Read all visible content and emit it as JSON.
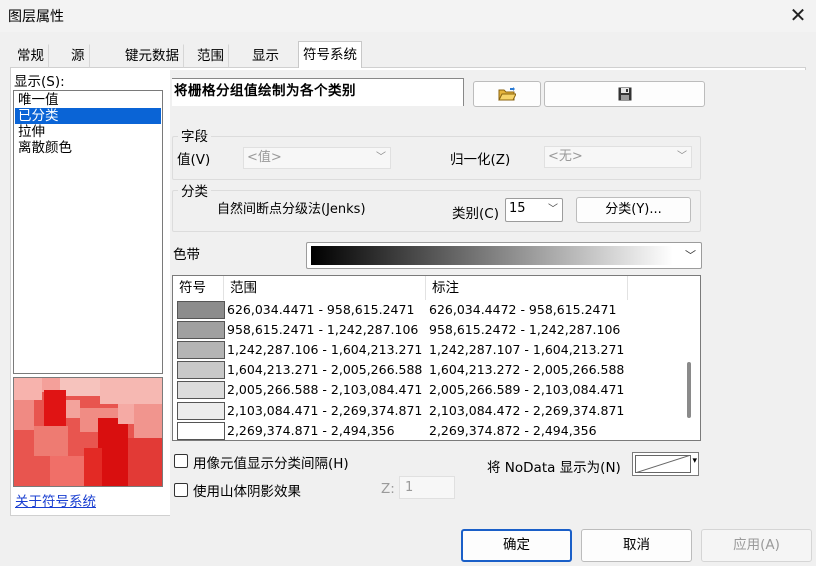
{
  "window": {
    "title": "图层属性",
    "close_icon": "close-icon"
  },
  "tabs": [
    {
      "label": "常规"
    },
    {
      "label": "源"
    },
    {
      "label": "键元数据"
    },
    {
      "label": "范围"
    },
    {
      "label": "显示"
    },
    {
      "label": "符号系统",
      "active": true
    }
  ],
  "sidebar": {
    "show_label": "显示(S):",
    "items": [
      {
        "label": "唯一值"
      },
      {
        "label": "已分类",
        "selected": true
      },
      {
        "label": "拉伸"
      },
      {
        "label": "离散颜色"
      }
    ],
    "about_link": "关于符号系统"
  },
  "main": {
    "heading": "将栅格分组值绘制为各个类别",
    "open_icon": "folder-open-icon",
    "save_icon": "floppy-save-icon",
    "field_group": {
      "title": "字段",
      "value_label": "值(V)",
      "value_combo": "<值>",
      "normalize_label": "归一化(Z)",
      "normalize_combo": "<无>"
    },
    "classify_group": {
      "title": "分类",
      "method": "自然间断点分级法(Jenks)",
      "classes_label": "类别(C)",
      "classes_value": "15",
      "classify_button": "分类(Y)..."
    },
    "color_ramp_label": "色带",
    "table": {
      "headers": [
        "符号",
        "范围",
        "标注"
      ],
      "rows": [
        {
          "color": "#8c8c8c",
          "range": "626,034.4471 - 958,615.2471",
          "label": "626,034.4472 - 958,615.2471"
        },
        {
          "color": "#a0a0a0",
          "range": "958,615.2471 - 1,242,287.106",
          "label": "958,615.2472 - 1,242,287.106"
        },
        {
          "color": "#b4b4b4",
          "range": "1,242,287.106 - 1,604,213.271",
          "label": "1,242,287.107 - 1,604,213.271"
        },
        {
          "color": "#c8c8c8",
          "range": "1,604,213.271 - 2,005,266.588",
          "label": "1,604,213.272 - 2,005,266.588"
        },
        {
          "color": "#dcdcdc",
          "range": "2,005,266.588 - 2,103,084.471",
          "label": "2,005,266.589 - 2,103,084.471"
        },
        {
          "color": "#ececec",
          "range": "2,103,084.471 - 2,269,374.871",
          "label": "2,103,084.472 - 2,269,374.871"
        },
        {
          "color": "#ffffff",
          "range": "2,269,374.871 - 2,494,356",
          "label": "2,269,374.872 - 2,494,356"
        }
      ]
    },
    "show_class_breaks": "用像元值显示分类间隔(H)",
    "use_hillshade": "使用山体阴影效果",
    "z_label": "Z:",
    "z_value": "1",
    "nodata_label": "将 NoData 显示为(N)"
  },
  "footer": {
    "ok": "确定",
    "cancel": "取消",
    "apply": "应用(A)"
  }
}
